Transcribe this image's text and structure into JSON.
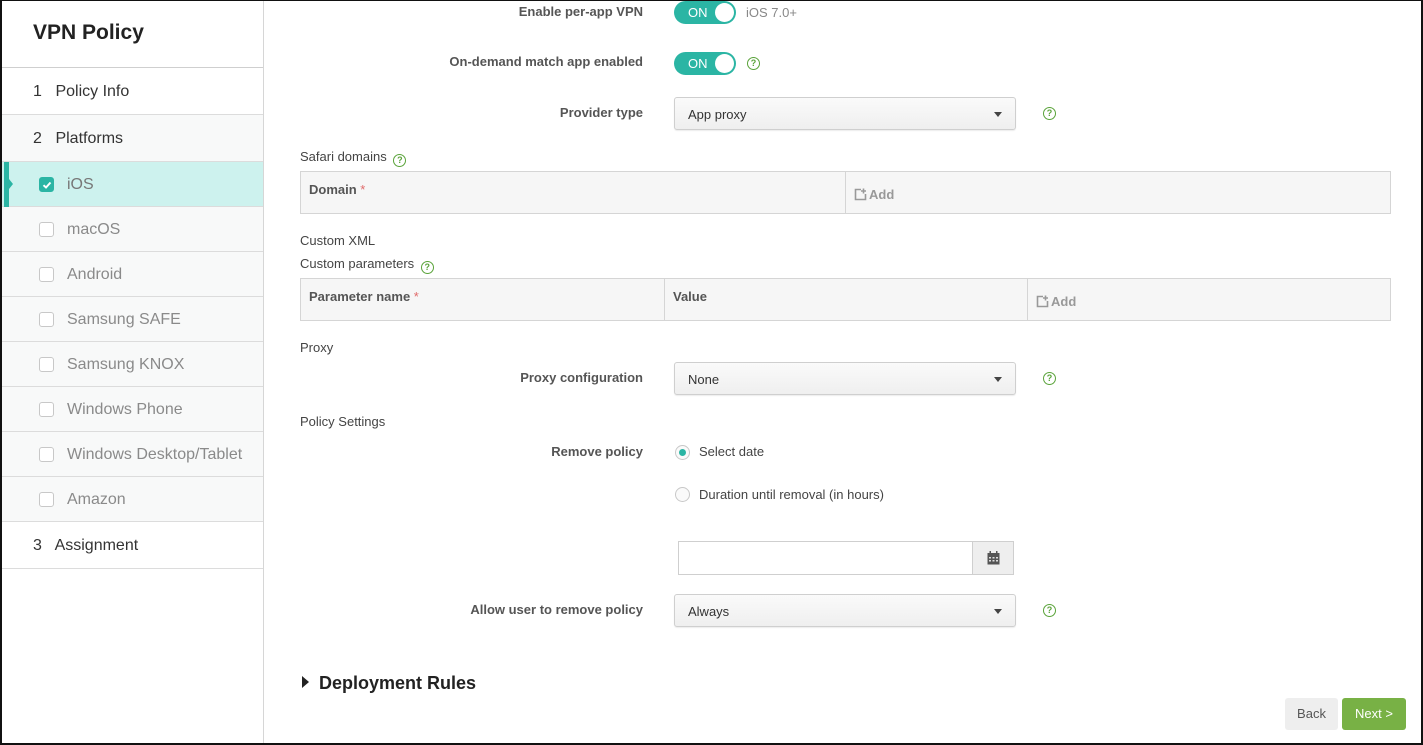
{
  "sidebar": {
    "title": "VPN Policy",
    "steps": [
      {
        "num": "1",
        "label": "Policy Info"
      },
      {
        "num": "2",
        "label": "Platforms"
      },
      {
        "num": "3",
        "label": "Assignment"
      }
    ],
    "platforms": [
      {
        "label": "iOS",
        "checked": true,
        "active": true
      },
      {
        "label": "macOS",
        "checked": false
      },
      {
        "label": "Android",
        "checked": false
      },
      {
        "label": "Samsung SAFE",
        "checked": false
      },
      {
        "label": "Samsung KNOX",
        "checked": false
      },
      {
        "label": "Windows Phone",
        "checked": false
      },
      {
        "label": "Windows Desktop/Tablet",
        "checked": false
      },
      {
        "label": "Amazon",
        "checked": false
      }
    ]
  },
  "form": {
    "per_app_vpn": {
      "label": "Enable per-app VPN",
      "state": "ON",
      "note": "iOS 7.0+"
    },
    "on_demand": {
      "label": "On-demand match app enabled",
      "state": "ON",
      "help": "?"
    },
    "provider_type": {
      "label": "Provider type",
      "value": "App proxy",
      "help": "?"
    },
    "safari_domains": {
      "title": "Safari domains",
      "help": "?",
      "columns": [
        {
          "label": "Domain",
          "required": "*"
        }
      ],
      "add_label": "Add"
    },
    "custom_xml": {
      "title": "Custom XML"
    },
    "custom_parameters": {
      "title": "Custom parameters",
      "help": "?",
      "columns": [
        {
          "label": "Parameter name",
          "required": "*"
        },
        {
          "label": "Value"
        }
      ],
      "add_label": "Add"
    },
    "proxy": {
      "title": "Proxy",
      "config_label": "Proxy configuration",
      "config_value": "None",
      "help": "?"
    },
    "policy_settings": {
      "title": "Policy Settings",
      "remove_policy_label": "Remove policy",
      "options": [
        {
          "label": "Select date",
          "selected": true
        },
        {
          "label": "Duration until removal (in hours)",
          "selected": false
        }
      ],
      "date_value": "",
      "allow_remove_label": "Allow user to remove policy",
      "allow_remove_value": "Always",
      "help": "?"
    },
    "deployment_rules": {
      "label": "Deployment Rules"
    }
  },
  "footer": {
    "back_label": "Back",
    "next_label": "Next >"
  },
  "colors": {
    "accent": "#2bb5a4",
    "next_button": "#78b145",
    "help_icon": "#5aa33a",
    "active_row": "#cdf2ee"
  }
}
